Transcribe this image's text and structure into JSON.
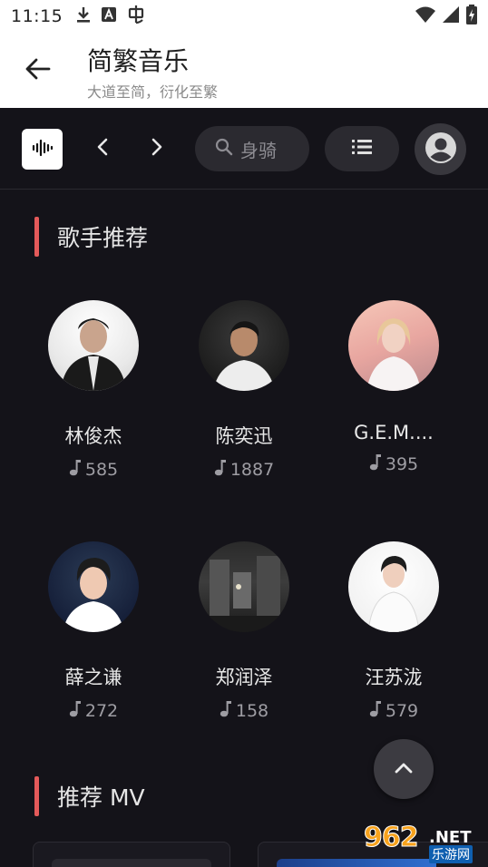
{
  "status_bar": {
    "time": "11:15",
    "icons": [
      "download-icon",
      "font-a-icon",
      "app-badge-icon",
      "wifi-icon",
      "signal-icon",
      "battery-charging-icon"
    ]
  },
  "app_bar": {
    "title": "简繁音乐",
    "subtitle": "大道至简，衍化至繁"
  },
  "toolbar": {
    "search_text": "身骑",
    "icons": [
      "waveform-logo-icon",
      "chevron-left-icon",
      "chevron-right-icon",
      "search-icon",
      "list-icon",
      "account-circle-icon"
    ]
  },
  "sections": {
    "singers": "歌手推荐",
    "mv": "推荐 MV"
  },
  "artists": [
    {
      "name": "林俊杰",
      "count": "585"
    },
    {
      "name": "陈奕迅",
      "count": "1887"
    },
    {
      "name": "G.E.M....",
      "count": "395"
    },
    {
      "name": "薛之谦",
      "count": "272"
    },
    {
      "name": "郑润泽",
      "count": "158"
    },
    {
      "name": "汪苏泷",
      "count": "579"
    }
  ],
  "colors": {
    "background": "#141319",
    "accent_bar": "#e45a5a",
    "pill": "#2b2a30"
  },
  "watermark": {
    "number": "962",
    "domain": ".NET",
    "label": "乐游网"
  }
}
